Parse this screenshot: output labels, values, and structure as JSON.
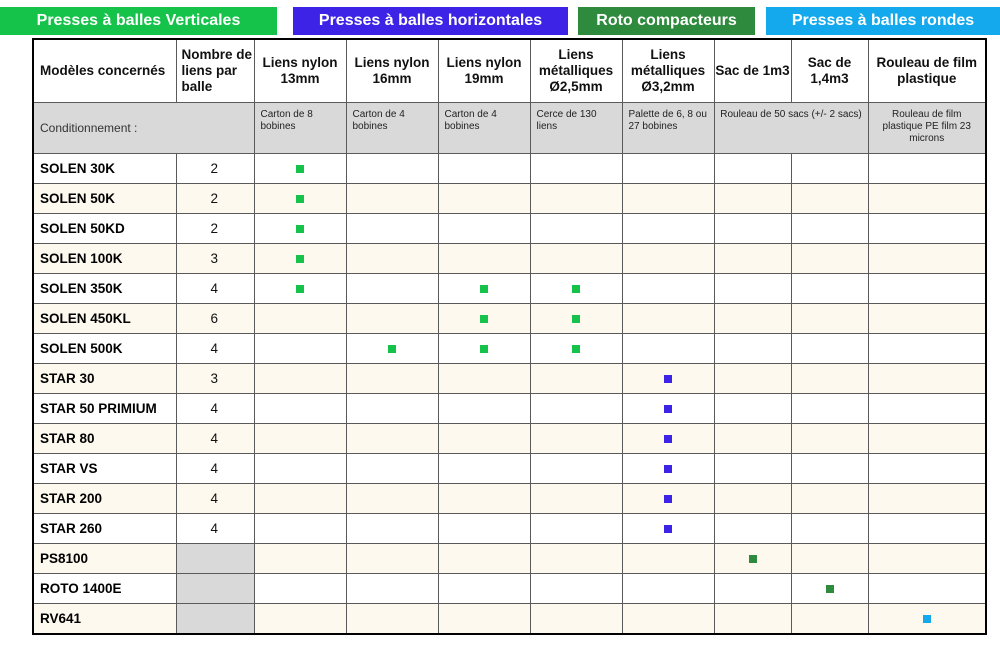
{
  "legend": [
    {
      "label": "Presses à  balles Verticales",
      "color": "#16c34a"
    },
    {
      "label": "Presses à balles horizontales",
      "color": "#3d23e6"
    },
    {
      "label": "Roto compacteurs",
      "color": "#2e8b3d"
    },
    {
      "label": "Presses à balles rondes",
      "color": "#14a9ec"
    }
  ],
  "table": {
    "headers": {
      "model": "Modèles concernés",
      "count": "Nombre de liens par balle",
      "columns": [
        "Liens nylon 13mm",
        "Liens nylon 16mm",
        "Liens nylon 19mm",
        "Liens métalliques Ø2,5mm",
        "Liens métalliques Ø3,2mm",
        "Sac de 1m3",
        "Sac de 1,4m3",
        "Rouleau de film plastique"
      ]
    },
    "conditionnement": {
      "label": "Conditionnement :",
      "values": [
        "Carton de 8 bobines",
        "Carton de 4 bobines",
        "Carton de 4 bobines",
        "Cerce de 130 liens",
        "Palette de 6, 8 ou 27 bobines",
        "Rouleau de 50 sacs (+/- 2 sacs)",
        "Rouleau de film plastique PE film 23 microns"
      ]
    },
    "rows": [
      {
        "model": "SOLEN 30K",
        "count": "2",
        "marks": [
          0
        ],
        "group": 0
      },
      {
        "model": "SOLEN 50K",
        "count": "2",
        "marks": [
          0
        ],
        "group": 0
      },
      {
        "model": "SOLEN 50KD",
        "count": "2",
        "marks": [
          0
        ],
        "group": 0
      },
      {
        "model": "SOLEN 100K",
        "count": "3",
        "marks": [
          0
        ],
        "group": 0
      },
      {
        "model": "SOLEN 350K",
        "count": "4",
        "marks": [
          0,
          2,
          3
        ],
        "group": 0
      },
      {
        "model": "SOLEN 450KL",
        "count": "6",
        "marks": [
          2,
          3
        ],
        "group": 0
      },
      {
        "model": "SOLEN 500K",
        "count": "4",
        "marks": [
          1,
          2,
          3
        ],
        "group": 0
      },
      {
        "model": "STAR 30",
        "count": "3",
        "marks": [
          4
        ],
        "group": 1
      },
      {
        "model": "STAR 50 PRIMIUM",
        "count": "4",
        "marks": [
          4
        ],
        "group": 1
      },
      {
        "model": "STAR 80",
        "count": "4",
        "marks": [
          4
        ],
        "group": 1
      },
      {
        "model": "STAR VS",
        "count": "4",
        "marks": [
          4
        ],
        "group": 1
      },
      {
        "model": "STAR 200",
        "count": "4",
        "marks": [
          4
        ],
        "group": 1
      },
      {
        "model": "STAR 260",
        "count": "4",
        "marks": [
          4
        ],
        "group": 1
      },
      {
        "model": "PS8100",
        "count": "",
        "marks": [
          5
        ],
        "group": 2
      },
      {
        "model": "ROTO 1400E",
        "count": "",
        "marks": [
          6
        ],
        "group": 2
      },
      {
        "model": "RV641",
        "count": "",
        "marks": [
          7
        ],
        "group": 3
      }
    ]
  }
}
